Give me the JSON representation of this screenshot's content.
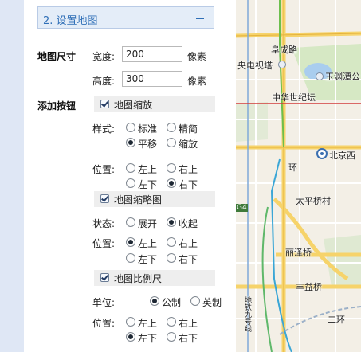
{
  "section": {
    "title": "2. 设置地图"
  },
  "map_size": {
    "label": "地图尺寸",
    "width_label": "宽度:",
    "width_value": "200",
    "height_label": "高度:",
    "height_value": "300",
    "unit": "像素"
  },
  "add_buttons": {
    "label": "添加按钮"
  },
  "zoom": {
    "title": "地图缩放",
    "style_label": "样式:",
    "style_options": [
      "标准",
      "精简",
      "平移",
      "缩放"
    ],
    "selected_style": "平移",
    "position_label": "位置:",
    "position_options": [
      "左上",
      "右上",
      "左下",
      "右下"
    ],
    "selected_position": "右下"
  },
  "overview": {
    "title": "地图缩略图",
    "state_label": "状态:",
    "state_options": [
      "展开",
      "收起"
    ],
    "selected_state": "收起",
    "position_label": "位置:",
    "position_options": [
      "左上",
      "右上",
      "左下",
      "右下"
    ],
    "selected_position": "左上"
  },
  "scale": {
    "title": "地图比例尺",
    "unit_label": "单位:",
    "unit_options": [
      "公制",
      "英制"
    ],
    "selected_unit": "公制",
    "position_label": "位置:",
    "position_options": [
      "左上",
      "右上",
      "左下",
      "右下"
    ],
    "selected_position": "左下"
  },
  "map": {
    "labels": [
      "阜成路",
      "央电视塔",
      "玉渊潭公",
      "中华世纪坛",
      "北京西",
      "环",
      "太平桥村",
      "丽泽桥",
      "丰益桥",
      "二环",
      "地铁九号线",
      "G4"
    ]
  },
  "colors": {
    "accent": "#2f6fb7",
    "header_bg": "#e4edf8"
  }
}
